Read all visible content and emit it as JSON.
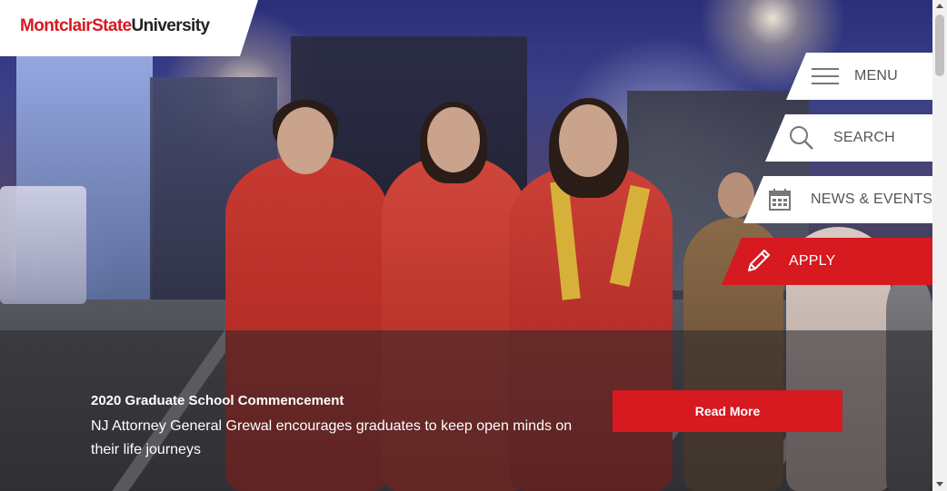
{
  "logo": {
    "part1": "Montclair",
    "part2": "State",
    "part3": "University"
  },
  "nav": {
    "menu": {
      "label": "MENU",
      "icon": "hamburger-icon"
    },
    "search": {
      "label": "SEARCH",
      "icon": "search-icon"
    },
    "news_events": {
      "label": "NEWS & EVENTS",
      "icon": "calendar-icon"
    },
    "apply": {
      "label": "APPLY",
      "icon": "pencil-icon"
    }
  },
  "hero": {
    "title": "2020 Graduate School Commencement",
    "description": "NJ Attorney General Grewal encourages graduates to keep open minds on their life journeys",
    "button_label": "Read More",
    "image": "graduates-walking-at-night-photo"
  },
  "colors": {
    "brand_red": "#d71920",
    "nav_text": "#555555",
    "white": "#ffffff"
  }
}
